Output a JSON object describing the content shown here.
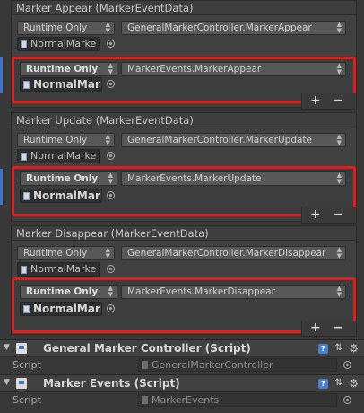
{
  "events": [
    {
      "header": "Marker Appear (MarkerEventData)",
      "entries": [
        {
          "mode": "Runtime Only",
          "object": "NormalMarke",
          "function": "GeneralMarkerController.MarkerAppear",
          "selected": false
        },
        {
          "mode": "Runtime Only",
          "object": "NormalMark",
          "function": "MarkerEvents.MarkerAppear",
          "selected": true
        }
      ]
    },
    {
      "header": "Marker Update (MarkerEventData)",
      "entries": [
        {
          "mode": "Runtime Only",
          "object": "NormalMarke",
          "function": "GeneralMarkerController.MarkerUpdate",
          "selected": false
        },
        {
          "mode": "Runtime Only",
          "object": "NormalMark",
          "function": "MarkerEvents.MarkerUpdate",
          "selected": true
        }
      ]
    },
    {
      "header": "Marker Disappear (MarkerEventData)",
      "entries": [
        {
          "mode": "Runtime Only",
          "object": "NormalMarke",
          "function": "GeneralMarkerController.MarkerDisappear",
          "selected": false
        },
        {
          "mode": "Runtime Only",
          "object": "NormalMark",
          "function": "MarkerEvents.MarkerDisappear",
          "selected": true
        }
      ]
    }
  ],
  "list_controls": {
    "add": "+",
    "remove": "−"
  },
  "components": [
    {
      "title": "General Marker Controller (Script)",
      "script_label": "Script",
      "script_value": "GeneralMarkerController",
      "help": "?"
    },
    {
      "title": "Marker Events (Script)",
      "script_label": "Script",
      "script_value": "MarkerEvents",
      "help": "?"
    }
  ],
  "colors": {
    "selection": "#e01e1e",
    "accent": "#3f74c9"
  }
}
